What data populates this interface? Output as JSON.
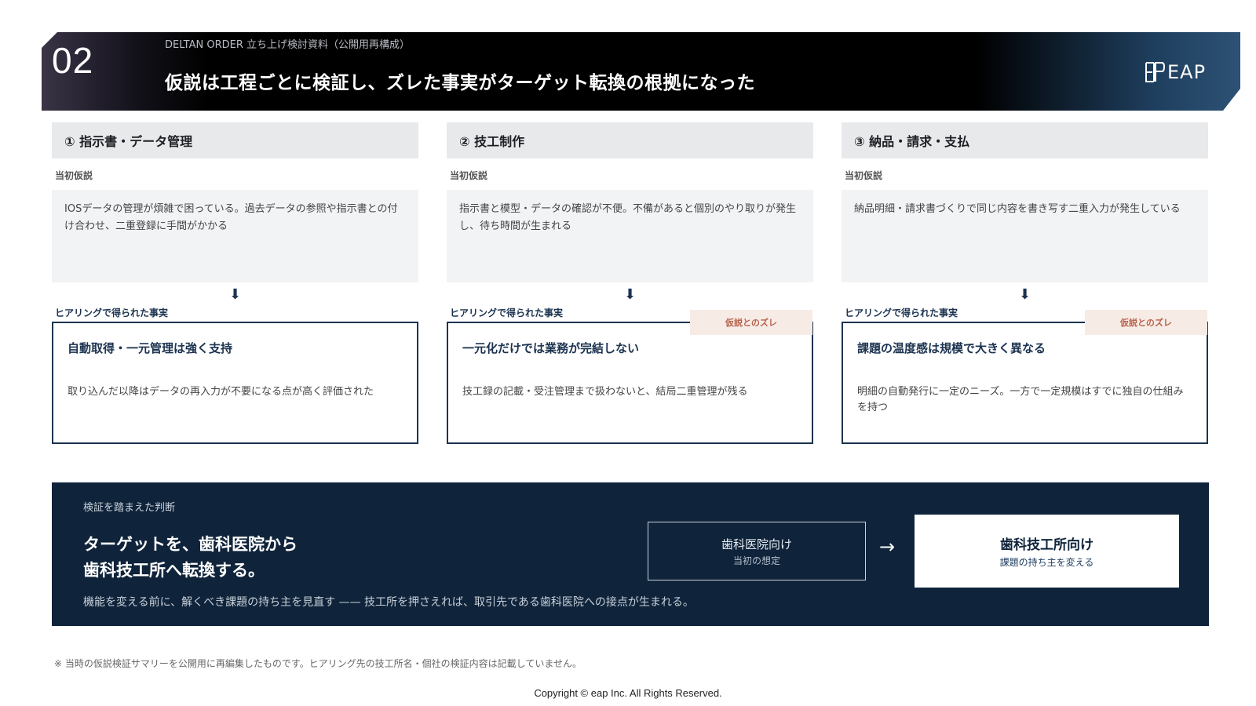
{
  "header": {
    "slide_number": "02",
    "doc_label": "DELTAN ORDER 立ち上げ検討資料（公開用再構成）",
    "title": "仮説は工程ごとに検証し、ズレた事実がターゲット転換の根拠になった",
    "logo_text": "EAP",
    "logo_icon": "eap-logo-icon"
  },
  "columns": [
    {
      "heading": "① 指示書・データ管理",
      "hypothesis_label": "当初仮説",
      "hypothesis": "IOSデータの管理が煩雑で困っている。過去データの参照や指示書との付け合わせ、二重登録に手間がかかる",
      "fact_label": "ヒアリングで得られた事実",
      "badge": "",
      "fact_title": "自動取得・一元管理は強く支持",
      "fact_body": "取り込んだ以降はデータの再入力が不要になる点が高く評価された"
    },
    {
      "heading": "② 技工制作",
      "hypothesis_label": "当初仮説",
      "hypothesis": "指示書と模型・データの確認が不便。不備があると個別のやり取りが発生し、待ち時間が生まれる",
      "fact_label": "ヒアリングで得られた事実",
      "badge": "仮説とのズレ",
      "fact_title": "一元化だけでは業務が完結しない",
      "fact_body": "技工録の記載・受注管理まで扱わないと、結局二重管理が残る"
    },
    {
      "heading": "③ 納品・請求・支払",
      "hypothesis_label": "当初仮説",
      "hypothesis": "納品明細・請求書づくりで同じ内容を書き写す二重入力が発生している",
      "fact_label": "ヒアリングで得られた事実",
      "badge": "仮説とのズレ",
      "fact_title": "課題の温度感は規模で大きく異なる",
      "fact_body": "明細の自動発行に一定のニーズ。一方で一定規模はすでに独自の仕組みを持つ"
    }
  ],
  "decision": {
    "label": "検証を踏まえた判断",
    "headline_line1": "ターゲットを、歯科医院から",
    "headline_line2": "歯科技工所へ転換する。",
    "sub": "機能を変える前に、解くべき課題の持ち主を見直す —— 技工所を押さえれば、取引先である歯科医院への接点が生まれる。",
    "from_title": "歯科医院向け",
    "from_sub": "当初の想定",
    "arrow": "→",
    "to_title": "歯科技工所向け",
    "to_sub": "課題の持ち主を変える"
  },
  "footer": {
    "note": "※ 当時の仮説検証サマリーを公開用に再編集したものです。ヒアリング先の技工所名・個社の検証内容は記載していません。",
    "copyright": "Copyright © eap Inc. All Rights Reserved."
  },
  "colors": {
    "navy": "#0f243b",
    "accent_navy": "#1c3350",
    "badge_bg": "#f6ebe5",
    "badge_text": "#b8604a"
  }
}
